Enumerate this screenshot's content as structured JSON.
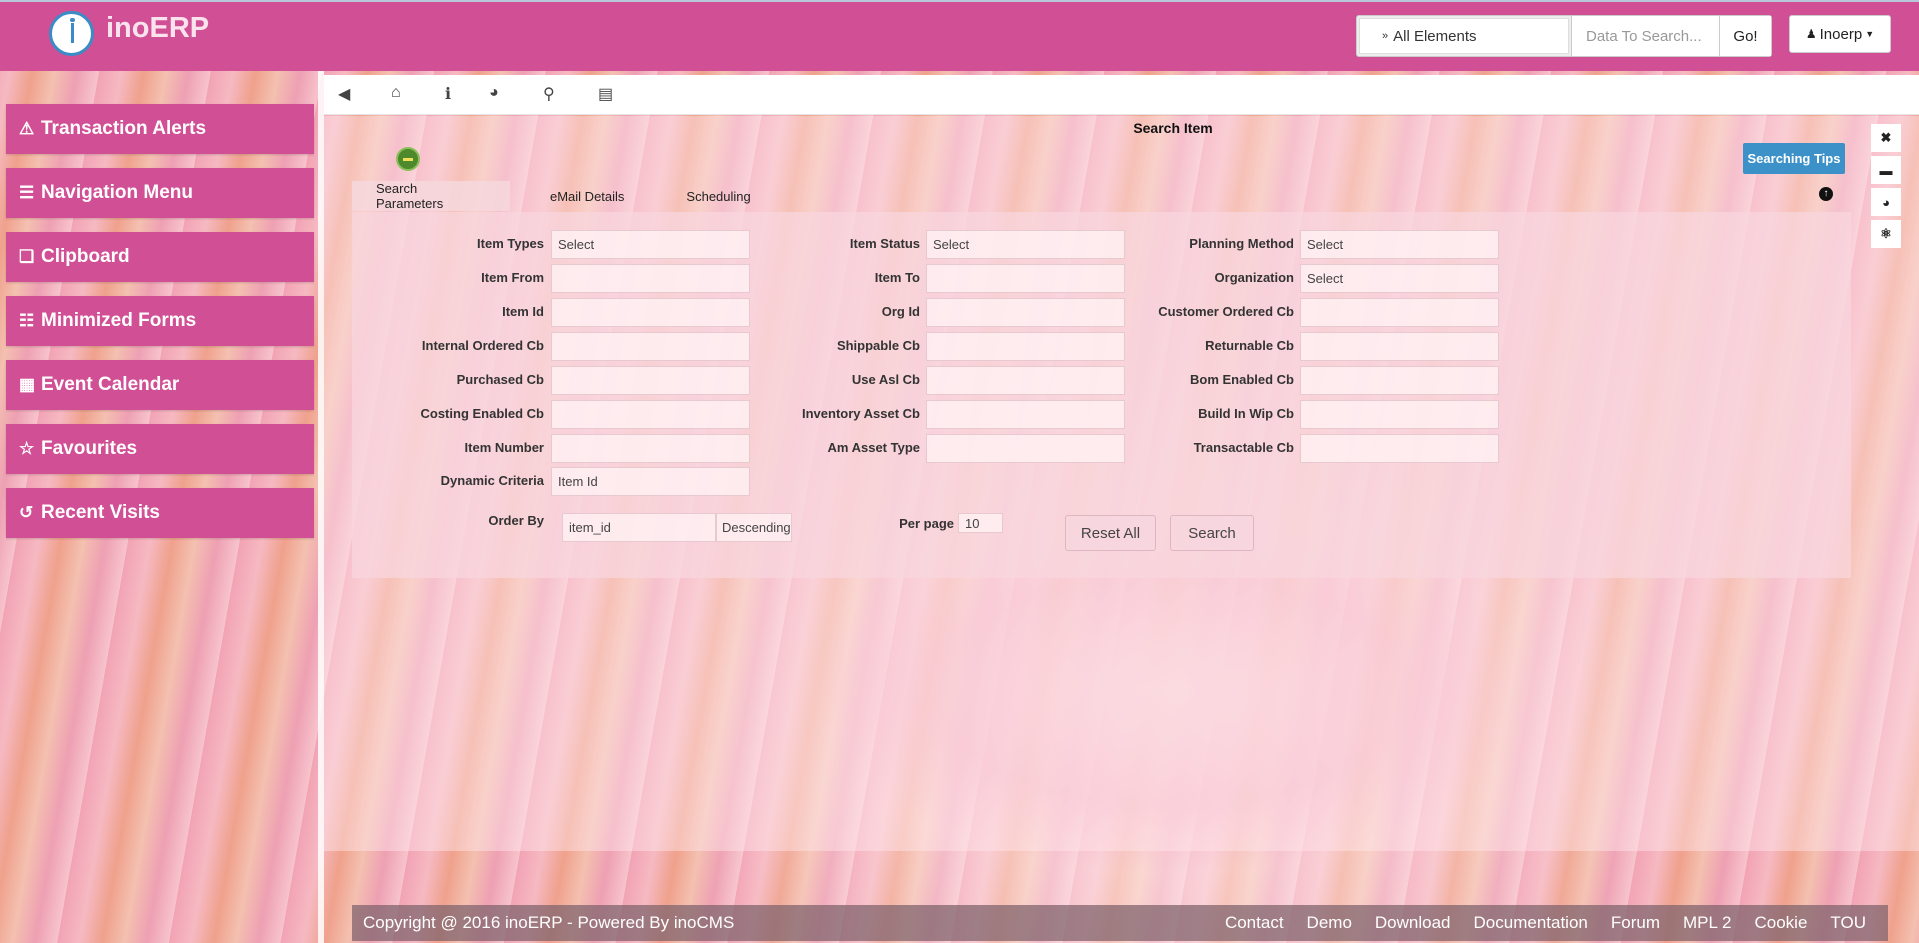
{
  "header": {
    "brand": "inoERP",
    "search_scope": "All Elements",
    "search_placeholder": "Data To Search...",
    "go_label": "Go!",
    "user_label": "Inoerp"
  },
  "sidebar": {
    "items": [
      {
        "icon": "warning-icon",
        "label": "Transaction Alerts"
      },
      {
        "icon": "menu-icon",
        "label": "Navigation Menu"
      },
      {
        "icon": "clipboard-icon",
        "label": "Clipboard"
      },
      {
        "icon": "file-icon",
        "label": "Minimized Forms"
      },
      {
        "icon": "calendar-icon",
        "label": "Event Calendar"
      },
      {
        "icon": "star-icon",
        "label": "Favourites"
      },
      {
        "icon": "history-icon",
        "label": "Recent Visits"
      }
    ]
  },
  "toolbar": {
    "icons": [
      "collapse-icon",
      "home-icon",
      "info-icon",
      "dashboard-icon",
      "search-icon",
      "window-icon"
    ]
  },
  "page": {
    "title": "Search Item",
    "tips_label": "Searching Tips"
  },
  "tabs": [
    "Search Parameters",
    "eMail Details",
    "Scheduling"
  ],
  "form": {
    "col1": [
      {
        "label": "Item Types",
        "value": "Select"
      },
      {
        "label": "Item From",
        "value": ""
      },
      {
        "label": "Item Id",
        "value": ""
      },
      {
        "label": "Internal Ordered Cb",
        "value": ""
      },
      {
        "label": "Purchased Cb",
        "value": ""
      },
      {
        "label": "Costing Enabled Cb",
        "value": ""
      },
      {
        "label": "Item Number",
        "value": ""
      },
      {
        "label": "Dynamic Criteria",
        "value": "Item Id"
      }
    ],
    "col2": [
      {
        "label": "Item Status",
        "value": "Select"
      },
      {
        "label": "Item To",
        "value": ""
      },
      {
        "label": "Org Id",
        "value": ""
      },
      {
        "label": "Shippable Cb",
        "value": ""
      },
      {
        "label": "Use Asl Cb",
        "value": ""
      },
      {
        "label": "Inventory Asset Cb",
        "value": ""
      },
      {
        "label": "Am Asset Type",
        "value": ""
      }
    ],
    "col3": [
      {
        "label": "Planning Method",
        "value": "Select"
      },
      {
        "label": "Organization",
        "value": "Select"
      },
      {
        "label": "Customer Ordered Cb",
        "value": ""
      },
      {
        "label": "Returnable Cb",
        "value": ""
      },
      {
        "label": "Bom Enabled Cb",
        "value": ""
      },
      {
        "label": "Build In Wip Cb",
        "value": ""
      },
      {
        "label": "Transactable Cb",
        "value": ""
      }
    ],
    "order_by_label": "Order By",
    "order_by_value": "item_id",
    "order_dir": "Descending",
    "per_page_label": "Per page",
    "per_page_value": "10",
    "reset_label": "Reset All",
    "search_label": "Search"
  },
  "footer": {
    "copyright": "Copyright @ 2016 inoERP - Powered By inoCMS",
    "links": [
      "Contact",
      "Demo",
      "Download",
      "Documentation",
      "Forum",
      "MPL 2",
      "Cookie",
      "TOU"
    ]
  }
}
